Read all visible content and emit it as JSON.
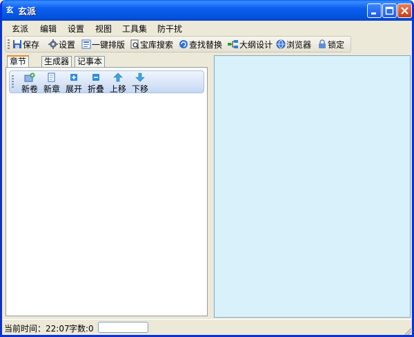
{
  "window": {
    "title": "玄派",
    "app_icon_glyph": "玄"
  },
  "menu": [
    "玄派",
    "编辑",
    "设置",
    "视图",
    "工具集",
    "防干扰"
  ],
  "toolbar": {
    "save": "保存",
    "settings": "设置",
    "one_click_layout": "一键排版",
    "library_search": "宝库搜索",
    "find_replace": "查找替换",
    "outline_design": "大纲设计",
    "browser": "浏览器",
    "lock": "锁定"
  },
  "tabs": [
    "章节",
    "生成器",
    "记事本"
  ],
  "chapter_tools": {
    "new_volume": "新卷",
    "new_chapter": "新章",
    "expand": "展开",
    "collapse": "折叠",
    "move_up": "上移",
    "move_down": "下移"
  },
  "status": {
    "time": "当前时间：22:07",
    "word_count": "字数:0"
  },
  "colors": {
    "titlebar": "#0452dc",
    "editor_background": "#d9f1fb",
    "window_face": "#ece9d8"
  }
}
